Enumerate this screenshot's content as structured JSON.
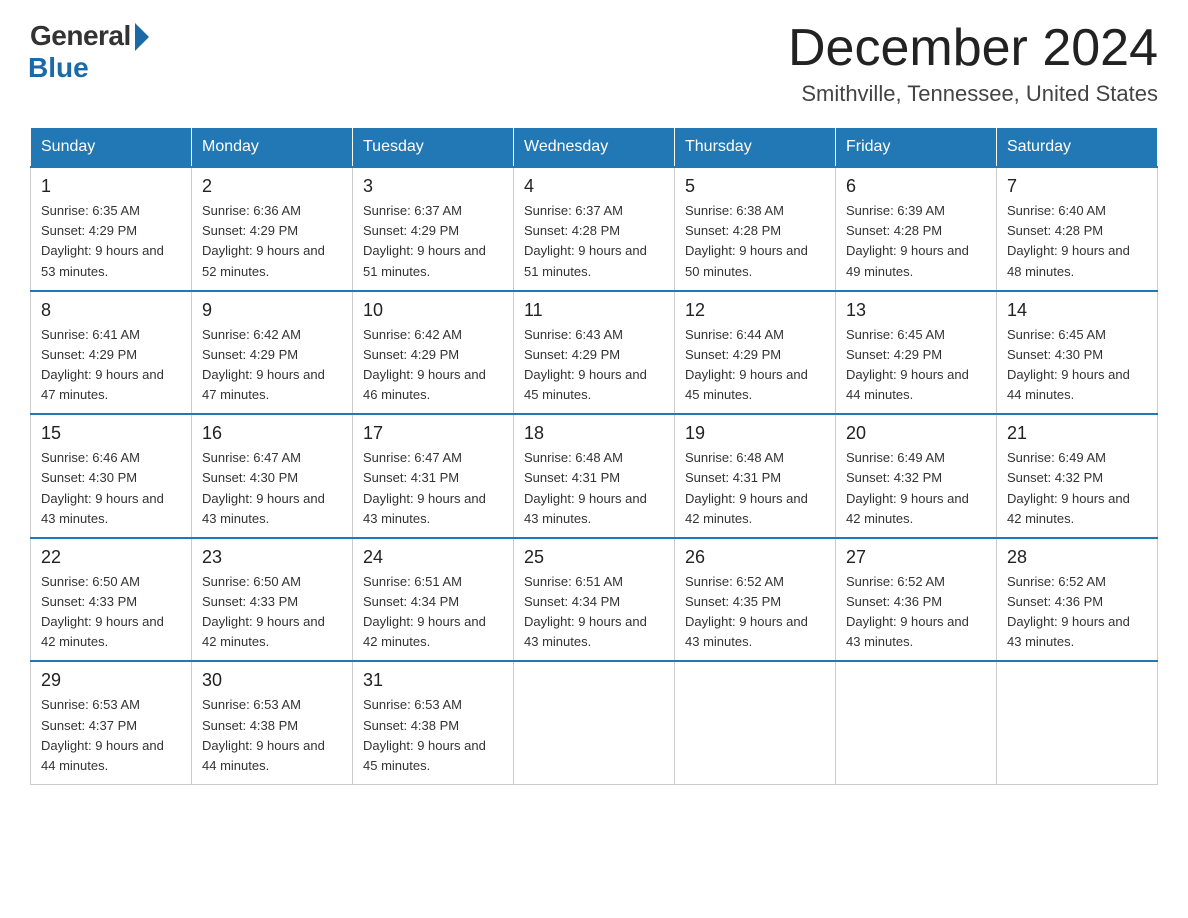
{
  "logo": {
    "general": "General",
    "blue": "Blue"
  },
  "header": {
    "month_year": "December 2024",
    "location": "Smithville, Tennessee, United States"
  },
  "weekdays": [
    "Sunday",
    "Monday",
    "Tuesday",
    "Wednesday",
    "Thursday",
    "Friday",
    "Saturday"
  ],
  "weeks": [
    [
      {
        "day": "1",
        "sunrise": "6:35 AM",
        "sunset": "4:29 PM",
        "daylight": "9 hours and 53 minutes."
      },
      {
        "day": "2",
        "sunrise": "6:36 AM",
        "sunset": "4:29 PM",
        "daylight": "9 hours and 52 minutes."
      },
      {
        "day": "3",
        "sunrise": "6:37 AM",
        "sunset": "4:29 PM",
        "daylight": "9 hours and 51 minutes."
      },
      {
        "day": "4",
        "sunrise": "6:37 AM",
        "sunset": "4:28 PM",
        "daylight": "9 hours and 51 minutes."
      },
      {
        "day": "5",
        "sunrise": "6:38 AM",
        "sunset": "4:28 PM",
        "daylight": "9 hours and 50 minutes."
      },
      {
        "day": "6",
        "sunrise": "6:39 AM",
        "sunset": "4:28 PM",
        "daylight": "9 hours and 49 minutes."
      },
      {
        "day": "7",
        "sunrise": "6:40 AM",
        "sunset": "4:28 PM",
        "daylight": "9 hours and 48 minutes."
      }
    ],
    [
      {
        "day": "8",
        "sunrise": "6:41 AM",
        "sunset": "4:29 PM",
        "daylight": "9 hours and 47 minutes."
      },
      {
        "day": "9",
        "sunrise": "6:42 AM",
        "sunset": "4:29 PM",
        "daylight": "9 hours and 47 minutes."
      },
      {
        "day": "10",
        "sunrise": "6:42 AM",
        "sunset": "4:29 PM",
        "daylight": "9 hours and 46 minutes."
      },
      {
        "day": "11",
        "sunrise": "6:43 AM",
        "sunset": "4:29 PM",
        "daylight": "9 hours and 45 minutes."
      },
      {
        "day": "12",
        "sunrise": "6:44 AM",
        "sunset": "4:29 PM",
        "daylight": "9 hours and 45 minutes."
      },
      {
        "day": "13",
        "sunrise": "6:45 AM",
        "sunset": "4:29 PM",
        "daylight": "9 hours and 44 minutes."
      },
      {
        "day": "14",
        "sunrise": "6:45 AM",
        "sunset": "4:30 PM",
        "daylight": "9 hours and 44 minutes."
      }
    ],
    [
      {
        "day": "15",
        "sunrise": "6:46 AM",
        "sunset": "4:30 PM",
        "daylight": "9 hours and 43 minutes."
      },
      {
        "day": "16",
        "sunrise": "6:47 AM",
        "sunset": "4:30 PM",
        "daylight": "9 hours and 43 minutes."
      },
      {
        "day": "17",
        "sunrise": "6:47 AM",
        "sunset": "4:31 PM",
        "daylight": "9 hours and 43 minutes."
      },
      {
        "day": "18",
        "sunrise": "6:48 AM",
        "sunset": "4:31 PM",
        "daylight": "9 hours and 43 minutes."
      },
      {
        "day": "19",
        "sunrise": "6:48 AM",
        "sunset": "4:31 PM",
        "daylight": "9 hours and 42 minutes."
      },
      {
        "day": "20",
        "sunrise": "6:49 AM",
        "sunset": "4:32 PM",
        "daylight": "9 hours and 42 minutes."
      },
      {
        "day": "21",
        "sunrise": "6:49 AM",
        "sunset": "4:32 PM",
        "daylight": "9 hours and 42 minutes."
      }
    ],
    [
      {
        "day": "22",
        "sunrise": "6:50 AM",
        "sunset": "4:33 PM",
        "daylight": "9 hours and 42 minutes."
      },
      {
        "day": "23",
        "sunrise": "6:50 AM",
        "sunset": "4:33 PM",
        "daylight": "9 hours and 42 minutes."
      },
      {
        "day": "24",
        "sunrise": "6:51 AM",
        "sunset": "4:34 PM",
        "daylight": "9 hours and 42 minutes."
      },
      {
        "day": "25",
        "sunrise": "6:51 AM",
        "sunset": "4:34 PM",
        "daylight": "9 hours and 43 minutes."
      },
      {
        "day": "26",
        "sunrise": "6:52 AM",
        "sunset": "4:35 PM",
        "daylight": "9 hours and 43 minutes."
      },
      {
        "day": "27",
        "sunrise": "6:52 AM",
        "sunset": "4:36 PM",
        "daylight": "9 hours and 43 minutes."
      },
      {
        "day": "28",
        "sunrise": "6:52 AM",
        "sunset": "4:36 PM",
        "daylight": "9 hours and 43 minutes."
      }
    ],
    [
      {
        "day": "29",
        "sunrise": "6:53 AM",
        "sunset": "4:37 PM",
        "daylight": "9 hours and 44 minutes."
      },
      {
        "day": "30",
        "sunrise": "6:53 AM",
        "sunset": "4:38 PM",
        "daylight": "9 hours and 44 minutes."
      },
      {
        "day": "31",
        "sunrise": "6:53 AM",
        "sunset": "4:38 PM",
        "daylight": "9 hours and 45 minutes."
      },
      null,
      null,
      null,
      null
    ]
  ]
}
